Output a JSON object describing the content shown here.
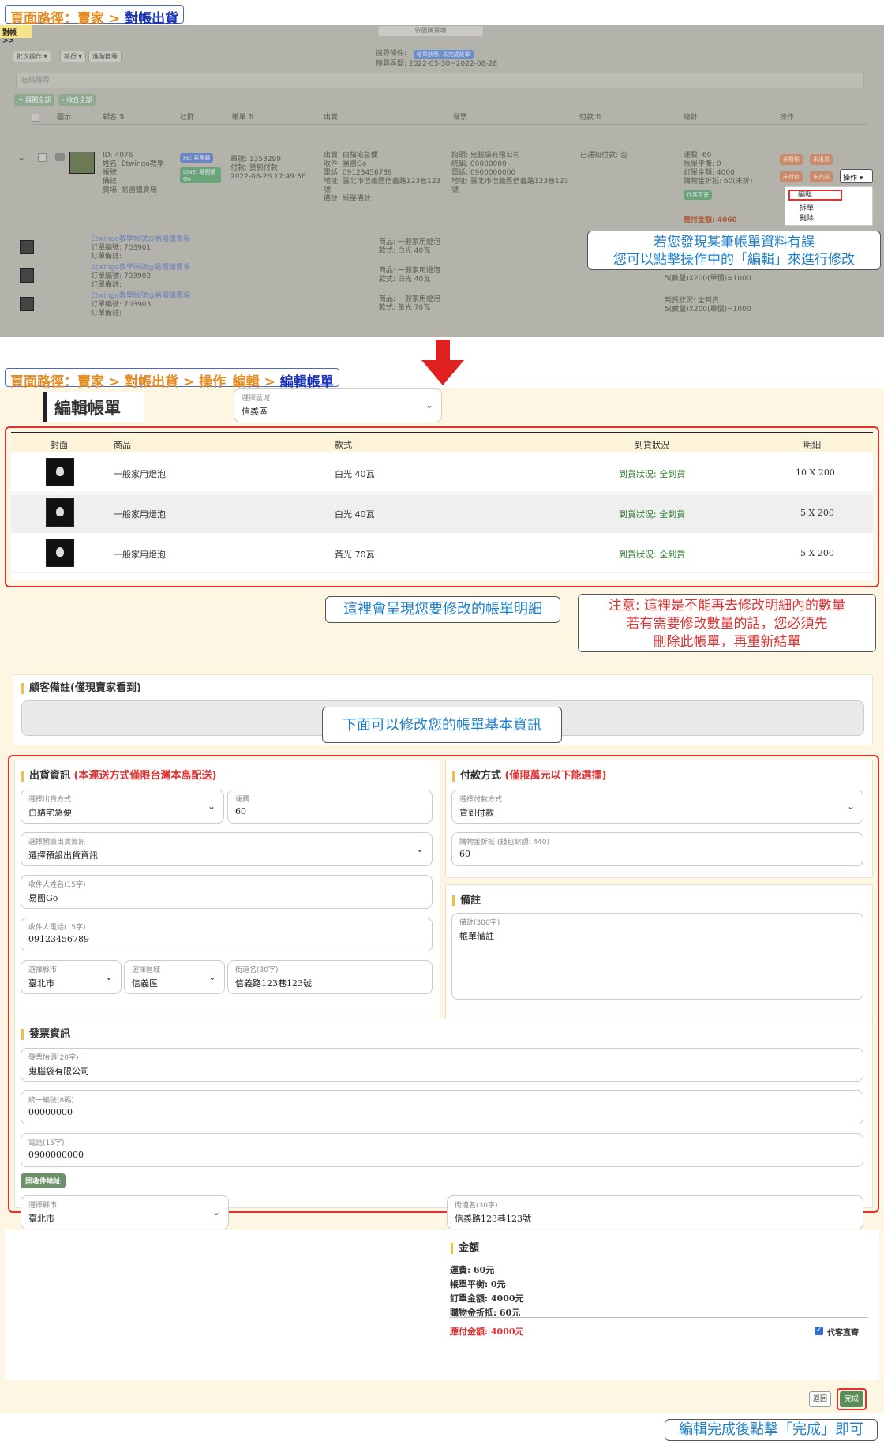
{
  "breadcrumb1": {
    "prefix": "頁面路徑：賣家 > ",
    "current": "對帳出貨"
  },
  "breadcrumb2": {
    "prefix": "頁面路徑：賣家 > 對帳出貨 > 操作_編輯 > ",
    "current": "編輯帳單"
  },
  "top": {
    "sidebar_tag": "對帳 >>",
    "top_select": "依團購賣場",
    "toolbar": [
      "批次操作 ▾",
      "執行 ▾",
      "進階搜尋"
    ],
    "filter_label": "搜尋條件:",
    "filter_badge": "帳單狀態: 未完成帳單",
    "filter_range": "搜尋區間: 2022-05-30~2022-08-28",
    "search_placeholder": "在結搜尋",
    "expand_all": "+ 展開全部",
    "collapse_all": "- 收合全部",
    "headers": [
      "圖示",
      "顧客 ⇅",
      "社群",
      "帳單 ⇅",
      "出貨",
      "發票",
      "付款 ⇅",
      "總計",
      "操作"
    ],
    "customer": "ID: 4076\n姓名: Etwingo教學帳號\n備註:\n賣場: 易團購賣場",
    "social_fb": "FB: 易團購",
    "social_line": "LINE: 易團購Go",
    "bill": "單號: 1358299\n付款: 貨到付款\n2022-08-26 17:49:36",
    "ship": "出貨: 白貓宅急便\n收件: 易團Go\n電話: 09123456789\n地址: 臺北市信義區信義路123巷123號\n備註: 帳單備註",
    "invoice": "抬頭: 鬼腦袋有限公司\n統編: 00000000\n電話: 0900000000\n地址: 臺北市信義區信義路123巷123號",
    "payment": "已通知付款: 否",
    "totals": "運費: 60\n帳單平衡: 0\n訂單金額: 4000\n購物金折抵: 60(未折)",
    "due": "應付金額: 4060",
    "action_button": "操作 ▾",
    "menu": [
      "編輯",
      "拆單",
      "刪除"
    ],
    "sub_rows": [
      {
        "buyer": "Etwingo教學帳號@易團購賣場",
        "order": "訂單編號: 703901\n訂單備註:",
        "product": "商品: 一般家用燈泡\n款式: 白光 40瓦",
        "status": "",
        "qty": ""
      },
      {
        "buyer": "Etwingo教學帳號@易團購賣場",
        "order": "訂單編號: 703902\n訂單備註:",
        "product": "商品: 一般家用燈泡\n款式: 白光 40瓦",
        "status": "",
        "qty": "5(數量)X200(單價)=1000"
      },
      {
        "buyer": "Etwingo教學帳號@易團購賣場",
        "order": "訂單編號: 703903\n訂單備註:",
        "product": "商品: 一般家用燈泡\n款式: 黃光 70瓦",
        "status": "到貨狀況: 全到貨",
        "qty": "5(數量)X200(單價)=1000"
      }
    ],
    "callout": "若您發現某筆帳單資料有誤\n您可以點擊操作中的「編輯」來進行修改"
  },
  "edit": {
    "title": "編輯帳單",
    "table_headers": [
      "封面",
      "商品",
      "款式",
      "到貨狀況",
      "明細"
    ],
    "rows": [
      {
        "product": "一般家用燈泡",
        "style": "白光 40瓦",
        "status": "到貨狀況: 全到貨",
        "detail": "10 X 200"
      },
      {
        "product": "一般家用燈泡",
        "style": "白光 40瓦",
        "status": "到貨狀況: 全到貨",
        "detail": "5 X 200"
      },
      {
        "product": "一般家用燈泡",
        "style": "黃光 70瓦",
        "status": "到貨狀況: 全到貨",
        "detail": "5 X 200"
      }
    ],
    "callout_detail": "這裡會呈現您要修改的帳單明細",
    "callout_warn": "注意: 這裡是不能再去修改明細內的數量\n若有需要修改數量的話，您必須先\n刪除此帳單，再重新結單",
    "customer_note_title": "顧客備註(僅現賣家看到)",
    "callout_basic": "下面可以修改您的帳單基本資訊",
    "ship_title": "出貨資訊",
    "ship_warn": "(本運送方式僅限台灣本島配送)",
    "pay_title": "付款方式",
    "pay_warn": "(僅限萬元以下能選擇)",
    "ship_method": {
      "label": "選擇出貨方式",
      "value": "白貓宅急便"
    },
    "ship_fee": {
      "label": "運費",
      "value": "60"
    },
    "preset": {
      "label": "選擇預設出貨資訊",
      "value": "選擇預設出貨資訊"
    },
    "recv_name": {
      "label": "收件人姓名(15字)",
      "value": "易團Go"
    },
    "recv_phone": {
      "label": "收件人電話(15字)",
      "value": "09123456789"
    },
    "city": {
      "label": "選擇縣市",
      "value": "臺北市"
    },
    "district": {
      "label": "選擇區域",
      "value": "信義區"
    },
    "street": {
      "label": "街道名(30字)",
      "value": "信義路123巷123號"
    },
    "pay_method": {
      "label": "選擇付款方式",
      "value": "貨到付款"
    },
    "credit": {
      "label": "購物金折抵 (錢包餘額: 440)",
      "value": "60"
    },
    "remark_title": "備註",
    "remark": {
      "label": "備註(300字)",
      "value": "帳單備註"
    },
    "invoice_title": "發票資訊",
    "inv_title": {
      "label": "發票抬頭(20字)",
      "value": "鬼腦袋有限公司"
    },
    "inv_tax": {
      "label": "統一編號(8碼)",
      "value": "00000000"
    },
    "inv_phone": {
      "label": "電話(15字)",
      "value": "0900000000"
    },
    "same_addr": "同收件地址",
    "inv_city": {
      "label": "選擇縣市",
      "value": "臺北市"
    },
    "inv_district": {
      "label": "選擇區域",
      "value": "信義區"
    },
    "inv_street": {
      "label": "街道名(30字)",
      "value": "信義路123巷123號"
    },
    "amount_title": "金額",
    "amount_lines": [
      "運費: 60元",
      "帳單平衡: 0元",
      "訂單金額: 4000元",
      "購物金折抵: 60元"
    ],
    "due": "應付金額: 4000元",
    "proxy_label": "代客直寄",
    "back": "返回",
    "done": "完成",
    "callout_done": "編輯完成後點擊「完成」即可"
  },
  "colors": {
    "accent_red": "#e53030",
    "callout_blue": "#1f7fc8",
    "breadcrumb_orange": "#e58a1f",
    "done_green": "#5b8c5a"
  },
  "icons": [
    "bulb-icon",
    "chevron-down-icon",
    "arrow-down-icon",
    "checkbox-icon"
  ]
}
